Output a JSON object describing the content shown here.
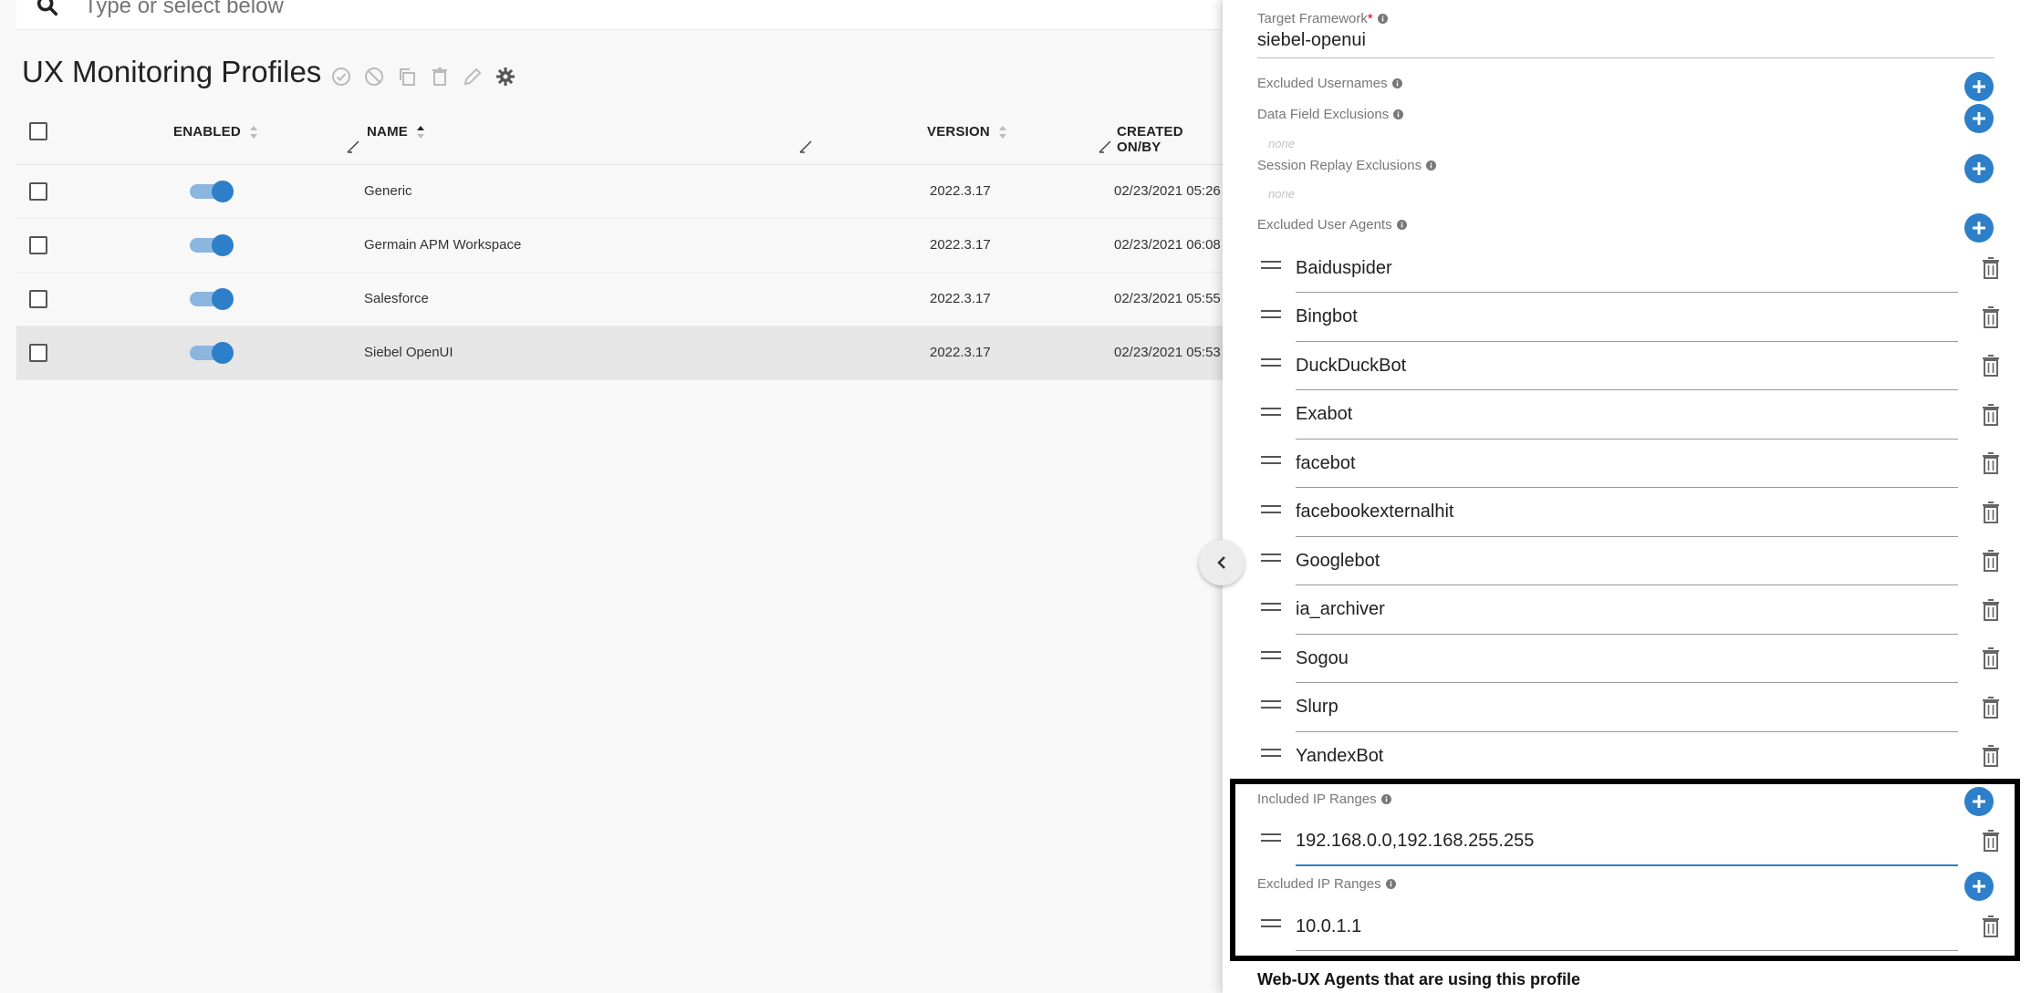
{
  "search": {
    "placeholder": "Type or select below"
  },
  "page": {
    "title": "UX Monitoring Profiles"
  },
  "grid": {
    "headers": {
      "enabled": "ENABLED",
      "name": "NAME",
      "version": "VERSION",
      "created": "CREATED ON/BY"
    },
    "rows": [
      {
        "enabled": true,
        "name": "Generic",
        "version": "2022.3.17",
        "created": "02/23/2021 05:26",
        "selected": false
      },
      {
        "enabled": true,
        "name": "Germain APM Workspace",
        "version": "2022.3.17",
        "created": "02/23/2021 06:08",
        "selected": false
      },
      {
        "enabled": true,
        "name": "Salesforce",
        "version": "2022.3.17",
        "created": "02/23/2021 05:55",
        "selected": false
      },
      {
        "enabled": true,
        "name": "Siebel OpenUI",
        "version": "2022.3.17",
        "created": "02/23/2021 05:53",
        "selected": true
      }
    ]
  },
  "panel": {
    "target_framework": {
      "label": "Target Framework",
      "required_mark": "*",
      "value": "siebel-openui"
    },
    "excluded_usernames": {
      "label": "Excluded Usernames"
    },
    "data_field_exclusions": {
      "label": "Data Field Exclusions",
      "empty": "none"
    },
    "session_replay_exclusions": {
      "label": "Session Replay Exclusions",
      "empty": "none"
    },
    "excluded_user_agents": {
      "label": "Excluded User Agents",
      "items": [
        "Baiduspider",
        "Bingbot",
        "DuckDuckBot",
        "Exabot",
        "facebot",
        "facebookexternalhit",
        "Googlebot",
        "ia_archiver",
        "Sogou",
        "Slurp",
        "YandexBot"
      ]
    },
    "included_ip_ranges": {
      "label": "Included IP Ranges",
      "items": [
        "192.168.0.0,192.168.255.255"
      ]
    },
    "excluded_ip_ranges": {
      "label": "Excluded IP Ranges",
      "items": [
        "10.0.1.1"
      ]
    },
    "agents_title": "Web-UX Agents that are using this profile"
  },
  "colors": {
    "accent": "#2d7fc9",
    "toggle_track": "#8ab6e0",
    "highlight_border": "#000000"
  }
}
